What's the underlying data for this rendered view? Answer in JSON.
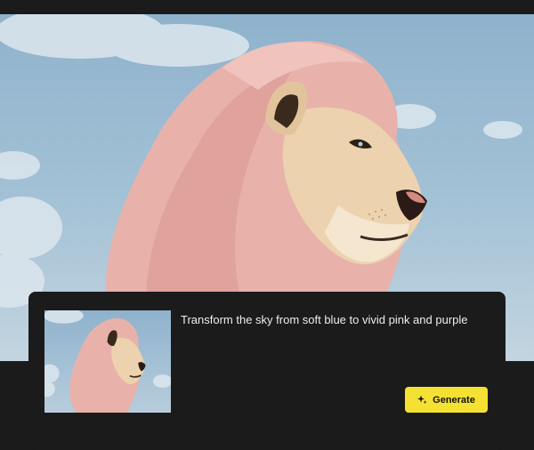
{
  "prompt": {
    "text": "Transform the sky from soft blue to vivid pink and purple"
  },
  "actions": {
    "generate_label": "Generate",
    "generate_icon": "sparkle-icon"
  },
  "colors": {
    "background": "#1b1b1c",
    "sky": "#a4c2d6",
    "mane": "#e8b2ab",
    "button": "#f5e132"
  }
}
